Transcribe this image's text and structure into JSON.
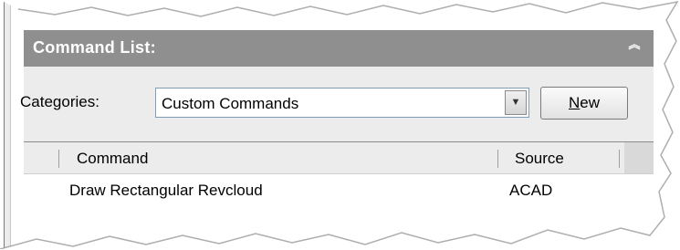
{
  "command_list": {
    "title": "Command List:",
    "collapse_icon": "chevron-up-double-icon"
  },
  "categories": {
    "label_prefix": "Cate",
    "label_mnemonic": "g",
    "label_suffix": "ories:",
    "selected": "Custom Commands"
  },
  "new_button": {
    "mnemonic": "N",
    "rest": "ew"
  },
  "list": {
    "columns": [
      "Command",
      "Source"
    ],
    "rows": [
      {
        "command": "Draw Rectangular Revcloud",
        "source": "ACAD"
      }
    ]
  },
  "colors": {
    "titlebar": "#8f8f8f",
    "panel": "#ececec"
  }
}
